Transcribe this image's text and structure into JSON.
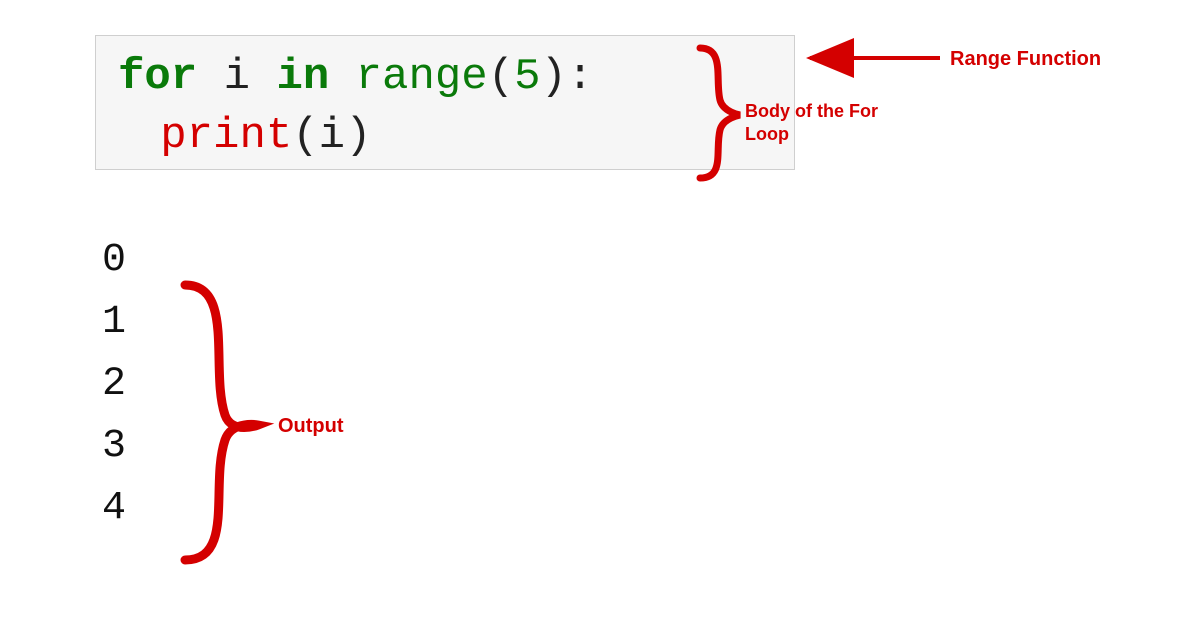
{
  "code": {
    "kw_for": "for",
    "var_i": "i",
    "kw_in": "in",
    "func_range": "range",
    "paren_open": "(",
    "arg": "5",
    "paren_close_colon": "):",
    "call_print": "print",
    "print_paren_open": "(",
    "print_arg": "i",
    "print_paren_close": ")"
  },
  "output": [
    "0",
    "1",
    "2",
    "3",
    "4"
  ],
  "annotations": {
    "range": "Range Function",
    "body": "Body of the For Loop",
    "output": "Output"
  },
  "colors": {
    "annotation": "#d40000",
    "code_bg": "#f6f6f6",
    "keyword": "#0a7a0a"
  }
}
